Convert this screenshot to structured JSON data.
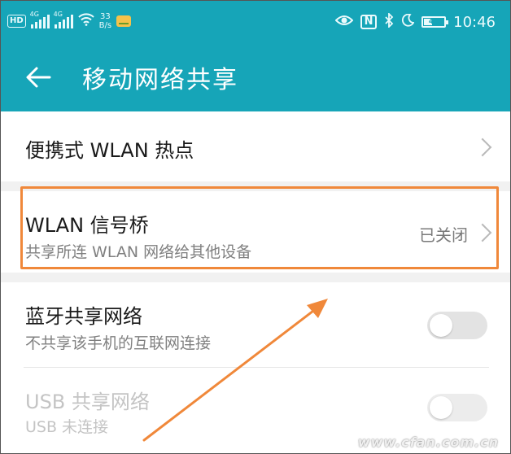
{
  "status_bar": {
    "hd_label": "HD",
    "net1": "4G",
    "net2": "4G",
    "speed_value": "33",
    "speed_unit": "B/s",
    "battery_percent": "40",
    "battery_level": 0.4,
    "time": "10:46",
    "nfc_label": "N"
  },
  "app_bar": {
    "title": "移动网络共享"
  },
  "items": {
    "hotspot": {
      "title": "便携式 WLAN 热点"
    },
    "bridge": {
      "title": "WLAN 信号桥",
      "subtitle": "共享所连 WLAN 网络给其他设备",
      "status": "已关闭"
    },
    "bluetooth": {
      "title": "蓝牙共享网络",
      "subtitle": "不共享该手机的互联网连接",
      "enabled": false
    },
    "usb": {
      "title": "USB 共享网络",
      "subtitle": "USB 未连接",
      "enabled": false,
      "disabled": true
    }
  },
  "colors": {
    "accent": "#16a5b8",
    "highlight": "#f0883a"
  },
  "icons": [
    "back-arrow-icon",
    "eye-icon",
    "nfc-icon",
    "bluetooth-icon",
    "moon-icon",
    "battery-icon",
    "wifi-icon",
    "signal-icon",
    "notification-app-icon",
    "chevron-right-icon"
  ],
  "watermark": "www.cfan.com.cn"
}
